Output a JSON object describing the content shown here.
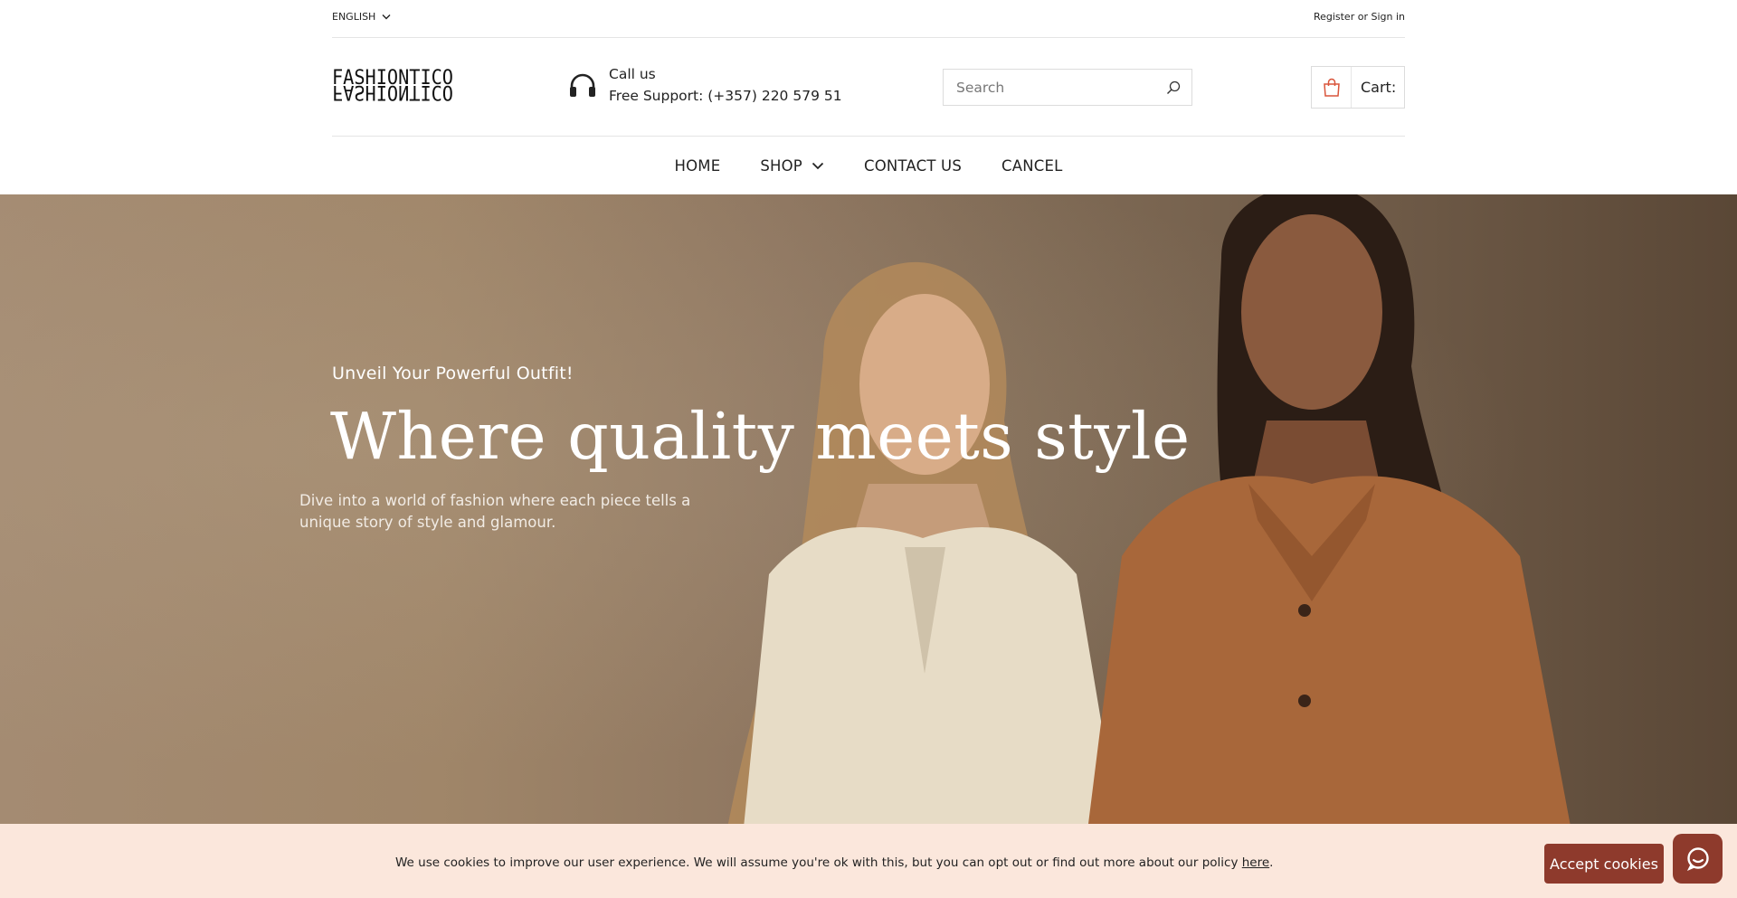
{
  "topbar": {
    "language": "ENGLISH",
    "auth_text": "Register or Sign in"
  },
  "header": {
    "logo_text": "FASHIONTICO",
    "support_line1": "Call us",
    "support_line2": "Free Support: (+357) 220 579 51",
    "search_placeholder": "Search",
    "cart_label": "Cart:"
  },
  "nav": {
    "items": [
      {
        "label": "HOME"
      },
      {
        "label": "SHOP"
      },
      {
        "label": "CONTACT US"
      },
      {
        "label": "CANCEL"
      }
    ]
  },
  "hero": {
    "eyebrow": "Unveil Your Powerful Outfit!",
    "title": "Where quality meets style",
    "description": "Dive into a world of fashion where each piece tells a unique story of style and glamour."
  },
  "cookie": {
    "message": "We use cookies to improve our user experience. We will assume you're ok with this, but you can opt out or find out more about our policy ",
    "link_text": "here",
    "period": ".",
    "accept_label": "Accept cookies"
  },
  "colors": {
    "accent": "#8e3a2c",
    "cookie_bg": "#fbe7dc",
    "cart_icon": "#d9553b"
  }
}
